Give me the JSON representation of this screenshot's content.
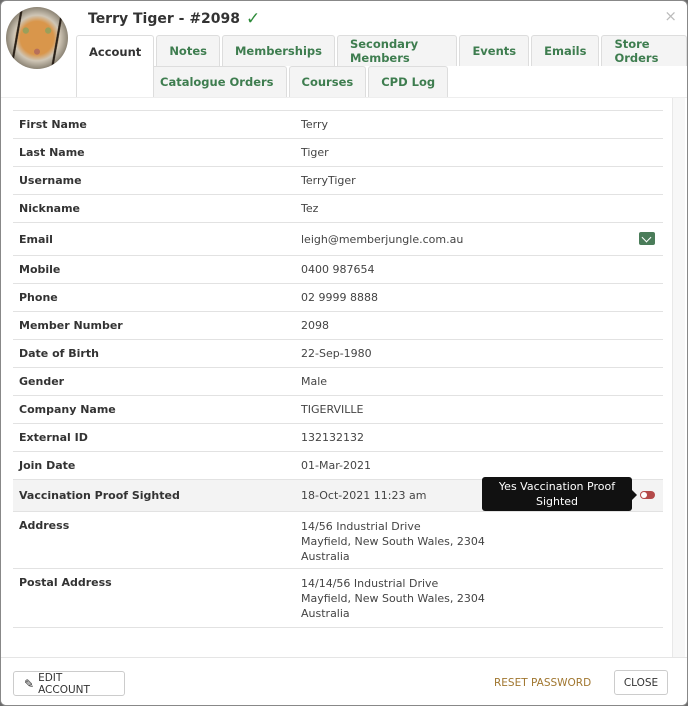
{
  "header": {
    "title": "Terry Tiger - #2098",
    "verified_icon": "check-icon",
    "close_icon": "×",
    "check_glyph": "✓"
  },
  "tabs": {
    "row1": [
      "Account",
      "Notes",
      "Memberships",
      "Secondary Members",
      "Events",
      "Emails",
      "Store Orders"
    ],
    "row2": [
      "Catalogue Orders",
      "Courses",
      "CPD Log"
    ],
    "active": "Account"
  },
  "fields": [
    {
      "label": "First Name",
      "value": "Terry"
    },
    {
      "label": "Last Name",
      "value": "Tiger"
    },
    {
      "label": "Username",
      "value": "TerryTiger"
    },
    {
      "label": "Nickname",
      "value": "Tez"
    },
    {
      "label": "Email",
      "value": "leigh@memberjungle.com.au",
      "icon": "mail-icon"
    },
    {
      "label": "Mobile",
      "value": "0400 987654"
    },
    {
      "label": "Phone",
      "value": "02 9999 8888"
    },
    {
      "label": "Member Number",
      "value": "2098"
    },
    {
      "label": "Date of Birth",
      "value": "22-Sep-1980"
    },
    {
      "label": "Gender",
      "value": "Male"
    },
    {
      "label": "Company Name",
      "value": "TIGERVILLE"
    },
    {
      "label": "External ID",
      "value": "132132132"
    },
    {
      "label": "Join Date",
      "value": "01-Mar-2021"
    },
    {
      "label": "Vaccination Proof Sighted",
      "value": "18-Oct-2021 11:23 am",
      "icon": "toggle-icon",
      "tooltip": "Yes Vaccination Proof Sighted"
    },
    {
      "label": "Address",
      "value": "14/56 Industrial Drive\nMayfield, New South Wales, 2304\nAustralia"
    },
    {
      "label": "Postal Address",
      "value": "14/14/56 Industrial Drive\nMayfield, New South Wales, 2304\nAustralia"
    }
  ],
  "footer": {
    "edit_label": "EDIT ACCOUNT",
    "reset_label": "RESET PASSWORD",
    "close_label": "CLOSE"
  },
  "colors": {
    "accent_green": "#3e7d4f",
    "reset_link": "#a0762f",
    "toggle_red": "#b44a4a"
  }
}
